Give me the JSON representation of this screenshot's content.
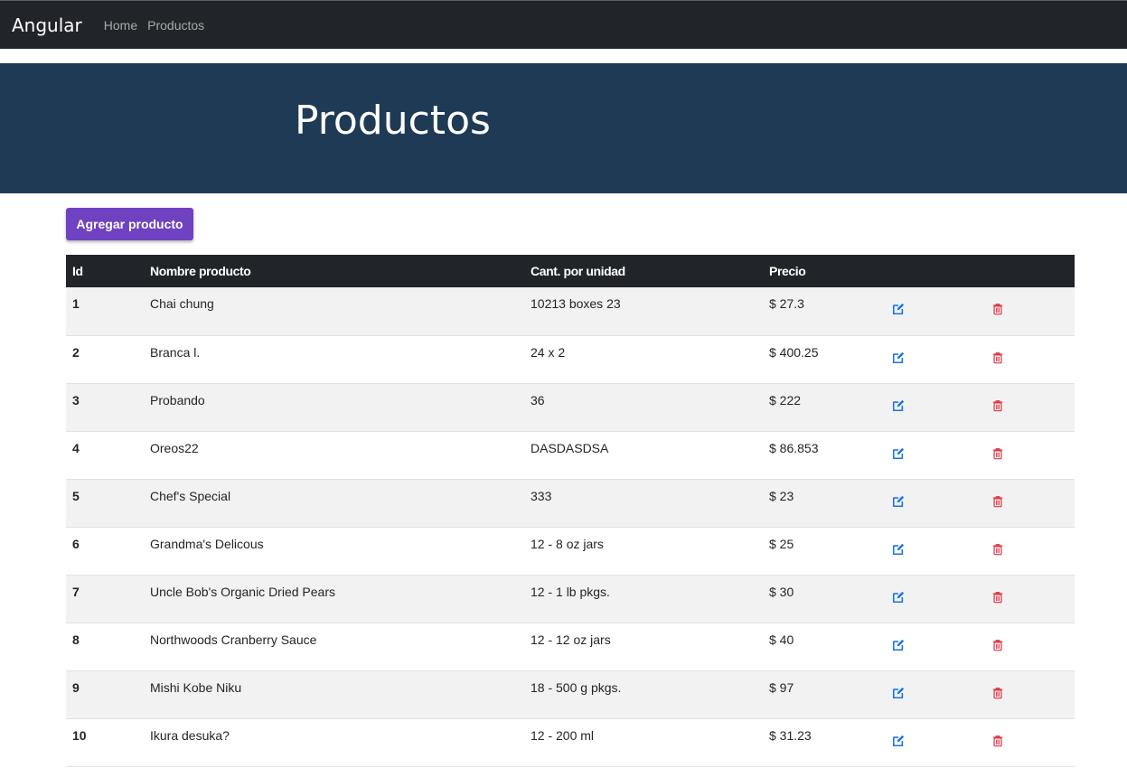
{
  "navbar": {
    "brand": "Angular",
    "links": [
      "Home",
      "Productos"
    ]
  },
  "hero": {
    "title": "Productos"
  },
  "actions": {
    "add_label": "Agregar producto"
  },
  "table": {
    "headers": [
      "Id",
      "Nombre producto",
      "Cant. por unidad",
      "Precio"
    ],
    "rows": [
      {
        "id": "1",
        "name": "Chai chung",
        "qty": "10213 boxes 23",
        "price": "$ 27.3"
      },
      {
        "id": "2",
        "name": "Branca l.",
        "qty": "24 x 2",
        "price": "$ 400.25"
      },
      {
        "id": "3",
        "name": "Probando",
        "qty": "36",
        "price": "$ 222"
      },
      {
        "id": "4",
        "name": "Oreos22",
        "qty": "DASDASDSA",
        "price": "$ 86.853"
      },
      {
        "id": "5",
        "name": "Chef's Special",
        "qty": "333",
        "price": "$ 23"
      },
      {
        "id": "6",
        "name": "Grandma's Delicous",
        "qty": "12 - 8 oz jars",
        "price": "$ 25"
      },
      {
        "id": "7",
        "name": "Uncle Bob's Organic Dried Pears",
        "qty": "12 - 1 lb pkgs.",
        "price": "$ 30"
      },
      {
        "id": "8",
        "name": "Northwoods Cranberry Sauce",
        "qty": "12 - 12 oz jars",
        "price": "$ 40"
      },
      {
        "id": "9",
        "name": "Mishi Kobe Niku",
        "qty": "18 - 500 g pkgs.",
        "price": "$ 97"
      },
      {
        "id": "10",
        "name": "Ikura desuka?",
        "qty": "12 - 200 ml",
        "price": "$ 31.23"
      }
    ]
  },
  "icons": {
    "edit": "edit-icon",
    "delete": "trash-icon"
  },
  "colors": {
    "navbar": "#212529",
    "hero": "#1e3a54",
    "button": "#6f42c1",
    "edit_icon": "#1a73e8",
    "delete_icon": "#dc3545"
  }
}
